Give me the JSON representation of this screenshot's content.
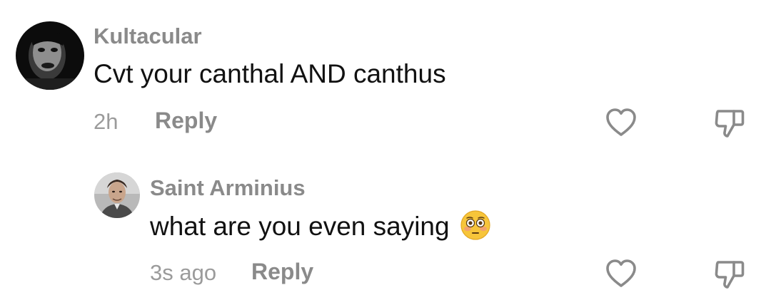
{
  "comments": [
    {
      "username": "Kultacular",
      "text": "Cvt your canthal AND canthus",
      "time": "2h",
      "reply_label": "Reply",
      "avatar_icon": "dark-face-avatar",
      "like_icon": "heart-outline-icon",
      "dislike_icon": "thumbs-down-outline-icon"
    },
    {
      "username": "Saint Arminius",
      "text": "what are you even saying",
      "emoji": "flushed-face-emoji",
      "time": "3s ago",
      "reply_label": "Reply",
      "avatar_icon": "man-portrait-avatar",
      "like_icon": "heart-outline-icon",
      "dislike_icon": "thumbs-down-outline-icon"
    }
  ],
  "colors": {
    "username": "#8a8a8a",
    "text": "#111111",
    "meta": "#9b9b9b",
    "icon": "#8a8a8a",
    "background": "#ffffff"
  }
}
